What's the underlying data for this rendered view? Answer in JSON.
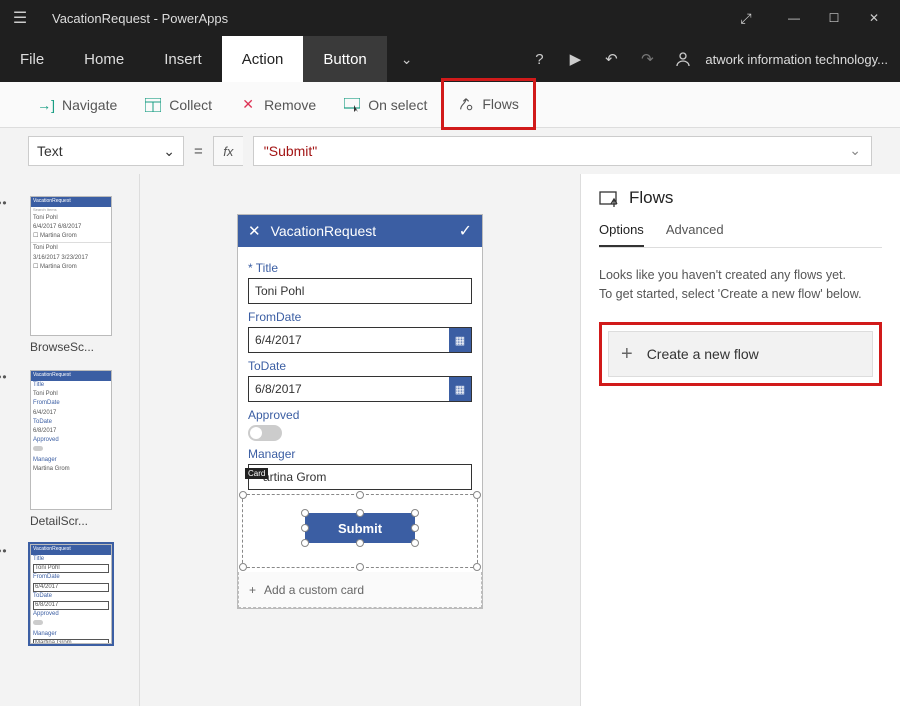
{
  "titlebar": {
    "appTitle": "VacationRequest - PowerApps"
  },
  "menu": {
    "file": "File",
    "home": "Home",
    "insert": "Insert",
    "action": "Action",
    "button": "Button",
    "user": "atwork information technology..."
  },
  "ribbon": {
    "navigate": "Navigate",
    "collect": "Collect",
    "remove": "Remove",
    "onselect": "On select",
    "flows": "Flows"
  },
  "formula": {
    "property": "Text",
    "expression": "\"Submit\""
  },
  "thumbs": {
    "browse": "BrowseSc...",
    "detail": "DetailScr...",
    "t1head": "VacationRequest",
    "t1a": "Toni Pohl",
    "t1b": "6/4/2017      6/8/2017",
    "t1c": "☐ Martina Grom",
    "t1d": "Toni Pohl",
    "t1e": "3/16/2017    3/23/2017",
    "t1f": "☐ Martina Grom",
    "d_title": "Title",
    "d_name": "Toni Pohl",
    "d_from": "FromDate",
    "d_fromv": "6/4/2017",
    "d_to": "ToDate",
    "d_tov": "6/8/2017",
    "d_app": "Approved",
    "d_mgr": "Manager",
    "d_mgrv": "Martina Grom"
  },
  "phone": {
    "header": "VacationRequest",
    "titleLabel": "Title",
    "titleValue": "Toni Pohl",
    "fromLabel": "FromDate",
    "fromValue": "6/4/2017",
    "toLabel": "ToDate",
    "toValue": "6/8/2017",
    "approvedLabel": "Approved",
    "managerLabel": "Manager",
    "managerValue": "artina Grom",
    "cardTag": "Card",
    "submit": "Submit",
    "addCard": "Add a custom card"
  },
  "panel": {
    "title": "Flows",
    "tabOptions": "Options",
    "tabAdvanced": "Advanced",
    "line1": "Looks like you haven't created any flows yet.",
    "line2": "To get started, select 'Create a new flow' below.",
    "newFlow": "Create a new flow"
  }
}
